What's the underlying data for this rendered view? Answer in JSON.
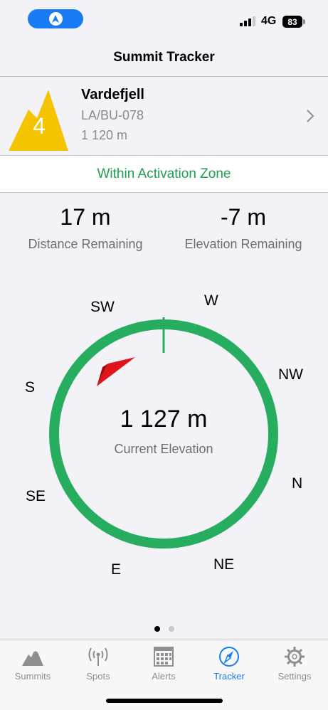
{
  "status": {
    "network": "4G",
    "battery": "83",
    "nav_icon": "location-arrow-icon"
  },
  "header": {
    "title": "Summit Tracker"
  },
  "summit": {
    "points": "4",
    "name": "Vardefjell",
    "reference": "LA/BU-078",
    "altitude": "1 120 m",
    "badge_color": "#f5c400"
  },
  "zone_status": {
    "text": "Within Activation Zone",
    "color": "#1e9e4e"
  },
  "stats": {
    "distance": {
      "value": "17 m",
      "label": "Distance Remaining"
    },
    "elevation": {
      "value": "-7 m",
      "label": "Elevation Remaining"
    }
  },
  "compass": {
    "directions": [
      "SW",
      "W",
      "NW",
      "N",
      "NE",
      "E",
      "SE",
      "S"
    ],
    "current_elevation": {
      "value": "1 127 m",
      "label": "Current Elevation"
    },
    "ring_color": "#27ad60",
    "pointer_color": "#e0141a"
  },
  "pager": {
    "pages": 2,
    "active": 0
  },
  "tabs": [
    {
      "label": "Summits",
      "icon": "mountain-icon"
    },
    {
      "label": "Spots",
      "icon": "antenna-icon"
    },
    {
      "label": "Alerts",
      "icon": "calendar-icon"
    },
    {
      "label": "Tracker",
      "icon": "compass-icon",
      "active": true
    },
    {
      "label": "Settings",
      "icon": "gear-icon"
    }
  ]
}
